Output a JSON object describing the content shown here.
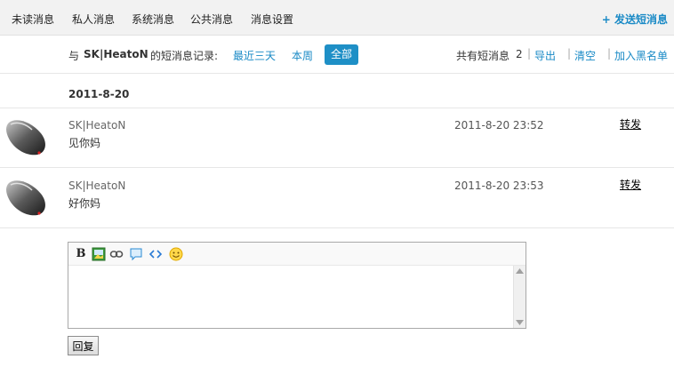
{
  "nav": {
    "tabs": [
      {
        "label": "未读消息"
      },
      {
        "label": "私人消息"
      },
      {
        "label": "系统消息"
      },
      {
        "label": "公共消息"
      },
      {
        "label": "消息设置"
      }
    ],
    "send_label": "+ 发送短消息"
  },
  "filter": {
    "prefix": "与",
    "user": "SK|HeatoN",
    "suffix": "的短消息记录:",
    "options": [
      {
        "label": "最近三天"
      },
      {
        "label": "本周"
      },
      {
        "label": "全部"
      }
    ],
    "total_label": "共有短消息",
    "total_count": "2",
    "actions": [
      {
        "label": "导出"
      },
      {
        "label": "清空"
      },
      {
        "label": "加入黑名单"
      }
    ]
  },
  "date_header": "2011-8-20",
  "messages": [
    {
      "author": "SK|HeatoN",
      "text": "见你妈",
      "time": "2011-8-20 23:52",
      "forward": "转发"
    },
    {
      "author": "SK|HeatoN",
      "text": "好你妈",
      "time": "2011-8-20 23:53",
      "forward": "转发"
    }
  ],
  "editor": {
    "toolbar": [
      {
        "icon": "bold-icon",
        "label": "B"
      },
      {
        "icon": "image-icon"
      },
      {
        "icon": "link-icon"
      },
      {
        "icon": "quote-icon"
      },
      {
        "icon": "code-icon"
      },
      {
        "icon": "smiley-icon"
      }
    ],
    "reply_label": "回复"
  },
  "colors": {
    "link": "#1a8ac6",
    "active_filter_bg": "#1e8fc6",
    "topbar_bg": "#f2f2f2"
  }
}
